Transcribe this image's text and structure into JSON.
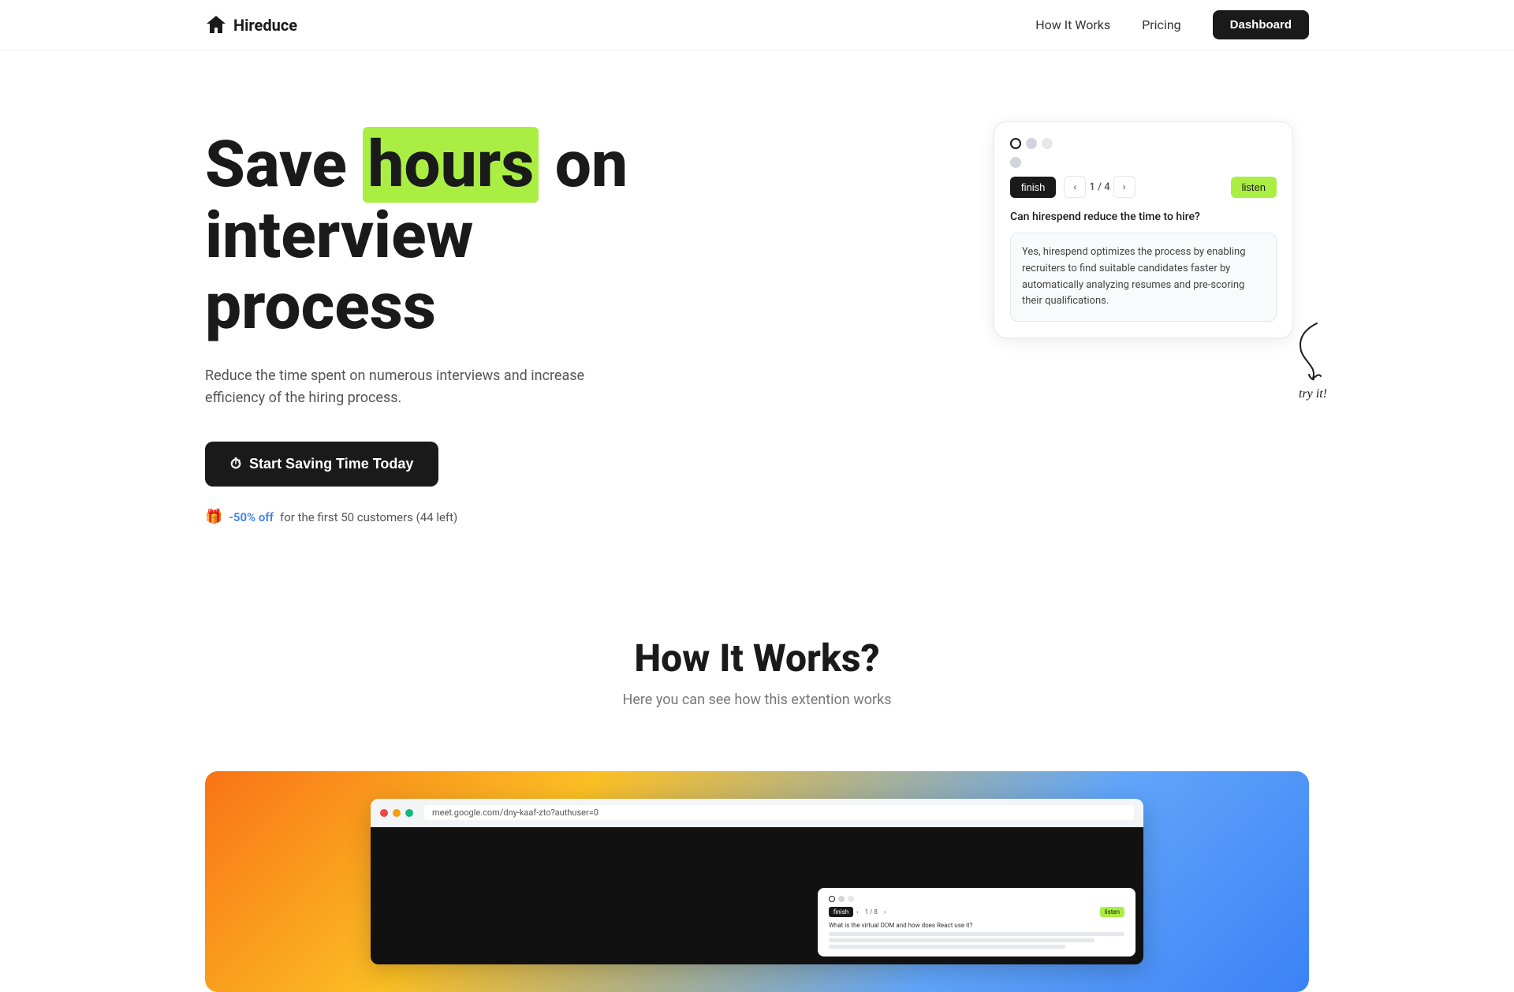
{
  "navbar": {
    "logo_text": "Hireduce",
    "logo_icon": "🏠",
    "links": [
      {
        "label": "How It Works",
        "id": "how-it-works"
      },
      {
        "label": "Pricing",
        "id": "pricing"
      }
    ],
    "dashboard_btn": "Dashboard"
  },
  "hero": {
    "title_part1": "Save ",
    "title_highlight": "hours",
    "title_part2": " on interview process",
    "subtitle": "Reduce the time spent on numerous interviews and increase efficiency of the hiring process.",
    "cta_label": "Start Saving Time Today",
    "promo_badge": "-50% off",
    "promo_text": "for the first 50 customers (44 left)"
  },
  "widget": {
    "nav_label": "finish",
    "page_indicator": "1 / 4",
    "listen_label": "listen",
    "question": "Can hirespend reduce the time to hire?",
    "answer": "Yes, hirespend optimizes the process by enabling recruiters to find suitable candidates faster by automatically analyzing resumes and pre-scoring their qualifications."
  },
  "try_it": {
    "label": "try it!"
  },
  "how_it_works": {
    "title": "How It Works?",
    "subtitle": "Here you can see how this extention works"
  },
  "demo_browser": {
    "url": "meet.google.com/dny-kaaf-zto?authuser=0",
    "mini_page": "1 / 8",
    "mini_question": "What is the virtual DOM and how does React use it?"
  }
}
